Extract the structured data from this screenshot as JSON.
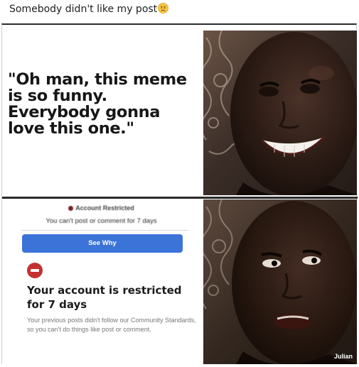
{
  "post": {
    "caption": "Somebody didn't like my post",
    "emoji_icon": "worried-face-emoji"
  },
  "meme": {
    "top_quote": "\"Oh man, this meme is so funny. Everybody gonna love this one.\"",
    "restricted_header": "Account Restricted",
    "restricted_subtext": "You can't post or comment for 7 days",
    "see_why_label": "See Why",
    "account_title": "Your account is restricted for 7 days",
    "account_body": "Your previous posts didn't follow our Community Standards, so you can't do things like post or comment.",
    "watermark": "Julian",
    "top_image_subject": "laughing-man-photo",
    "bottom_image_subject": "disappointed-man-photo"
  },
  "colors": {
    "button_blue": "#3b73d8",
    "warning_red": "#c53030",
    "divider": "#2a2a2a"
  }
}
